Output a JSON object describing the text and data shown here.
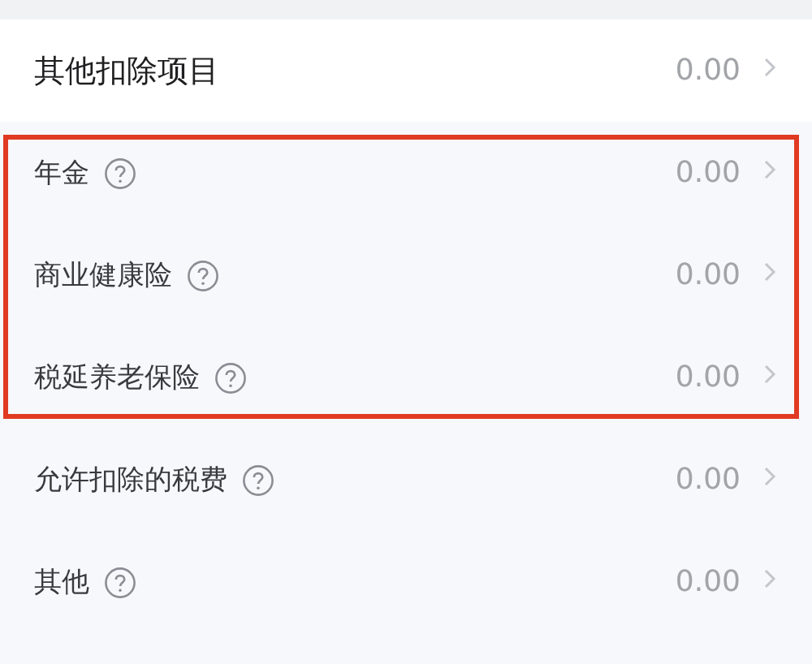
{
  "header_row": {
    "label": "其他扣除项目",
    "value": "0.00"
  },
  "rows": [
    {
      "label": "年金",
      "value": "0.00",
      "highlighted": true
    },
    {
      "label": "商业健康险",
      "value": "0.00",
      "highlighted": true
    },
    {
      "label": "税延养老保险",
      "value": "0.00",
      "highlighted": true
    },
    {
      "label": "允许扣除的税费",
      "value": "0.00",
      "highlighted": false
    },
    {
      "label": "其他",
      "value": "0.00",
      "highlighted": false
    }
  ]
}
